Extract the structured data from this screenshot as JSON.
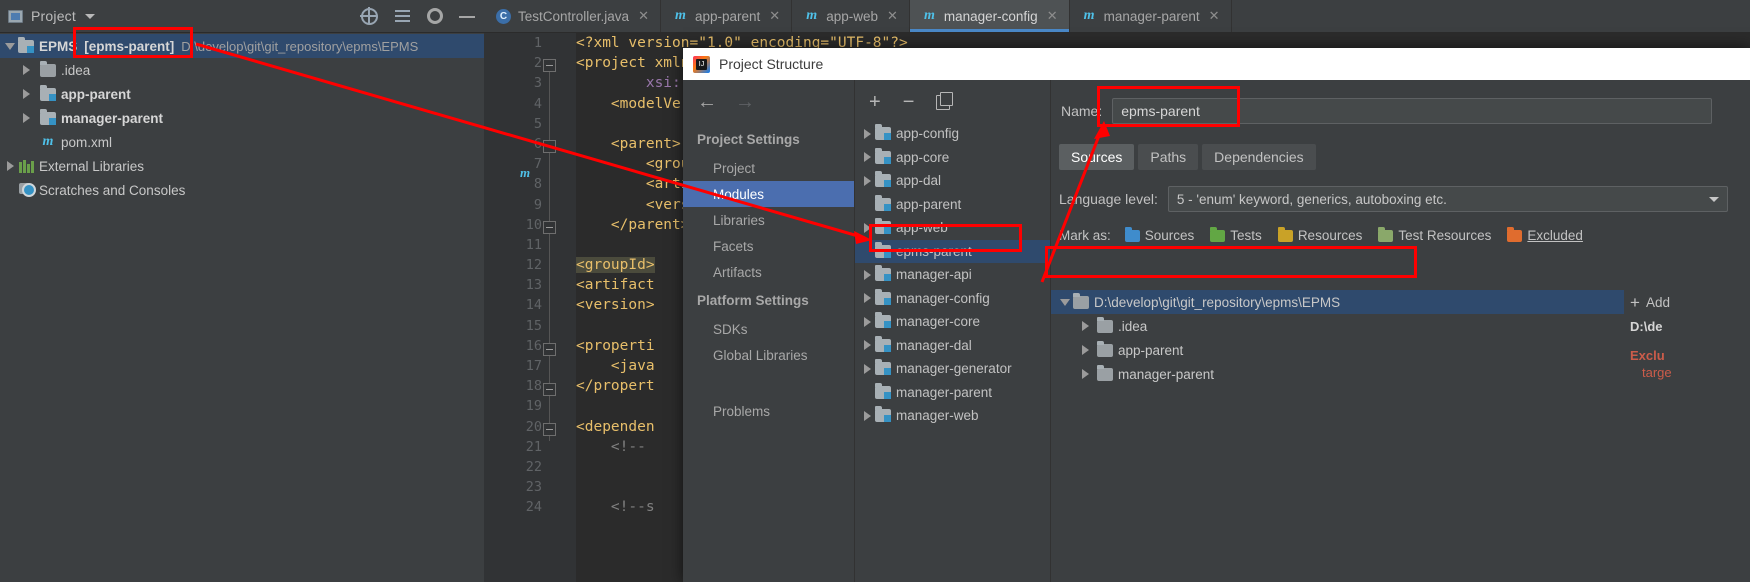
{
  "project_panel": {
    "title": "Project",
    "toolbar_icons": [
      "locate-icon",
      "collapse-all-icon",
      "settings-icon",
      "minimize-icon"
    ],
    "tree": [
      {
        "label": "EPMS",
        "secondary": "[epms-parent]",
        "path": "D:\\develop\\git\\git_repository\\epms\\EPMS",
        "icon": "module-folder-icon",
        "arrow": "expanded",
        "indent": 0,
        "selected": true,
        "bold": true
      },
      {
        "label": ".idea",
        "icon": "folder-icon",
        "arrow": "collapsed",
        "indent": 1,
        "selected": false,
        "bold": false
      },
      {
        "label": "app-parent",
        "icon": "module-folder-icon",
        "arrow": "collapsed",
        "indent": 1,
        "selected": false,
        "bold": true
      },
      {
        "label": "manager-parent",
        "icon": "module-folder-icon",
        "arrow": "collapsed",
        "indent": 1,
        "selected": false,
        "bold": true
      },
      {
        "label": "pom.xml",
        "icon": "maven-m-icon",
        "arrow": "none",
        "indent": 1,
        "selected": false,
        "bold": false
      },
      {
        "label": "External Libraries",
        "icon": "libraries-icon",
        "arrow": "collapsed",
        "indent": 0,
        "selected": false,
        "bold": false
      },
      {
        "label": "Scratches and Consoles",
        "icon": "scratches-icon",
        "arrow": "none",
        "indent": 0,
        "selected": false,
        "bold": false
      }
    ]
  },
  "editor": {
    "tabs": [
      {
        "label": "TestController.java",
        "icon": "java-class-icon",
        "active": false
      },
      {
        "label": "app-parent",
        "icon": "maven-m-icon",
        "active": false
      },
      {
        "label": "app-web",
        "icon": "maven-m-icon",
        "active": false
      },
      {
        "label": "manager-config",
        "icon": "maven-m-icon",
        "active": true
      },
      {
        "label": "manager-parent",
        "icon": "maven-m-icon",
        "active": false
      }
    ],
    "close_glyph": "✕",
    "lines": [
      {
        "n": 1,
        "text": "<?xml version=\"1.0\" encoding=\"UTF-8\"?>"
      },
      {
        "n": 2,
        "text": "<project xmln"
      },
      {
        "n": 3,
        "text": "        xsi:"
      },
      {
        "n": 4,
        "text": "    <modelVer"
      },
      {
        "n": 5,
        "text": ""
      },
      {
        "n": 6,
        "text": "    <parent>"
      },
      {
        "n": 7,
        "text": "        <grou"
      },
      {
        "n": 8,
        "text": "        <arti"
      },
      {
        "n": 9,
        "text": "        <vers"
      },
      {
        "n": 10,
        "text": "    </parent>"
      },
      {
        "n": 11,
        "text": ""
      },
      {
        "n": 12,
        "text": "<groupId>"
      },
      {
        "n": 13,
        "text": "<artifact"
      },
      {
        "n": 14,
        "text": "<version>"
      },
      {
        "n": 15,
        "text": ""
      },
      {
        "n": 16,
        "text": "<properti"
      },
      {
        "n": 17,
        "text": "    <java"
      },
      {
        "n": 18,
        "text": "</propert"
      },
      {
        "n": 19,
        "text": ""
      },
      {
        "n": 20,
        "text": "<dependen"
      },
      {
        "n": 21,
        "text": "    <!--"
      },
      {
        "n": 22,
        "text": ""
      },
      {
        "n": 23,
        "text": ""
      },
      {
        "n": 24,
        "text": "    <!--s"
      }
    ]
  },
  "dialog": {
    "title": "Project Structure",
    "nav_back": "←",
    "nav_forward": "→",
    "groups": [
      {
        "title": "Project Settings",
        "items": [
          {
            "label": "Project",
            "active": false
          },
          {
            "label": "Modules",
            "active": true
          },
          {
            "label": "Libraries",
            "active": false
          },
          {
            "label": "Facets",
            "active": false
          },
          {
            "label": "Artifacts",
            "active": false
          }
        ]
      },
      {
        "title": "Platform Settings",
        "items": [
          {
            "label": "SDKs",
            "active": false
          },
          {
            "label": "Global Libraries",
            "active": false
          }
        ]
      },
      {
        "title": "",
        "items": [
          {
            "label": "Problems",
            "active": false
          }
        ]
      }
    ],
    "modules_toolbar": {
      "add": "+",
      "remove": "−",
      "copy": "copy-icon"
    },
    "modules": [
      {
        "label": "app-config",
        "arrow": "collapsed",
        "selected": false
      },
      {
        "label": "app-core",
        "arrow": "collapsed",
        "selected": false
      },
      {
        "label": "app-dal",
        "arrow": "collapsed",
        "selected": false
      },
      {
        "label": "app-parent",
        "arrow": "none",
        "selected": false
      },
      {
        "label": "app-web",
        "arrow": "collapsed",
        "selected": false
      },
      {
        "label": "epms-parent",
        "arrow": "none",
        "selected": true
      },
      {
        "label": "manager-api",
        "arrow": "collapsed",
        "selected": false
      },
      {
        "label": "manager-config",
        "arrow": "collapsed",
        "selected": false
      },
      {
        "label": "manager-core",
        "arrow": "collapsed",
        "selected": false
      },
      {
        "label": "manager-dal",
        "arrow": "collapsed",
        "selected": false
      },
      {
        "label": "manager-generator",
        "arrow": "collapsed",
        "selected": false
      },
      {
        "label": "manager-parent",
        "arrow": "none",
        "selected": false
      },
      {
        "label": "manager-web",
        "arrow": "collapsed",
        "selected": false
      }
    ],
    "detail": {
      "name_label": "Name:",
      "name_value": "epms-parent",
      "tabs": [
        {
          "label": "Sources",
          "active": true
        },
        {
          "label": "Paths",
          "active": false
        },
        {
          "label": "Dependencies",
          "active": false
        }
      ],
      "language_level_label": "Language level:",
      "language_level_value": "5 - 'enum' keyword, generics, autoboxing etc.",
      "mark_as_label": "Mark as:",
      "mark_buttons": [
        {
          "label": "Sources",
          "color": "#3f8ccc",
          "icon": "sources-folder-icon"
        },
        {
          "label": "Tests",
          "color": "#62a744",
          "icon": "tests-folder-icon"
        },
        {
          "label": "Resources",
          "color": "#c9a227",
          "icon": "resources-folder-icon"
        },
        {
          "label": "Test Resources",
          "color": "#8aa86a",
          "icon": "test-resources-folder-icon"
        },
        {
          "label": "Excluded",
          "color": "#e06c2e",
          "icon": "excluded-folder-icon"
        }
      ],
      "source_tree": [
        {
          "label": "D:\\develop\\git\\git_repository\\epms\\EPMS",
          "arrow": "expanded",
          "indent": 0,
          "selected": true
        },
        {
          "label": ".idea",
          "arrow": "collapsed",
          "indent": 1,
          "selected": false
        },
        {
          "label": "app-parent",
          "arrow": "collapsed",
          "indent": 1,
          "selected": false
        },
        {
          "label": "manager-parent",
          "arrow": "collapsed",
          "indent": 1,
          "selected": false
        }
      ],
      "side_add_label": "Add",
      "side_path": "D:\\de",
      "side_excluded": "Exclu",
      "side_excluded_sub": "targe"
    }
  },
  "annotations": {
    "accent_color": "#ff0000",
    "boxes": [
      "project-name-box",
      "epms-parent-module-box",
      "name-field-box",
      "content-root-path-box"
    ],
    "arrows": [
      "arrow-to-module",
      "arrow-to-name-field"
    ]
  }
}
